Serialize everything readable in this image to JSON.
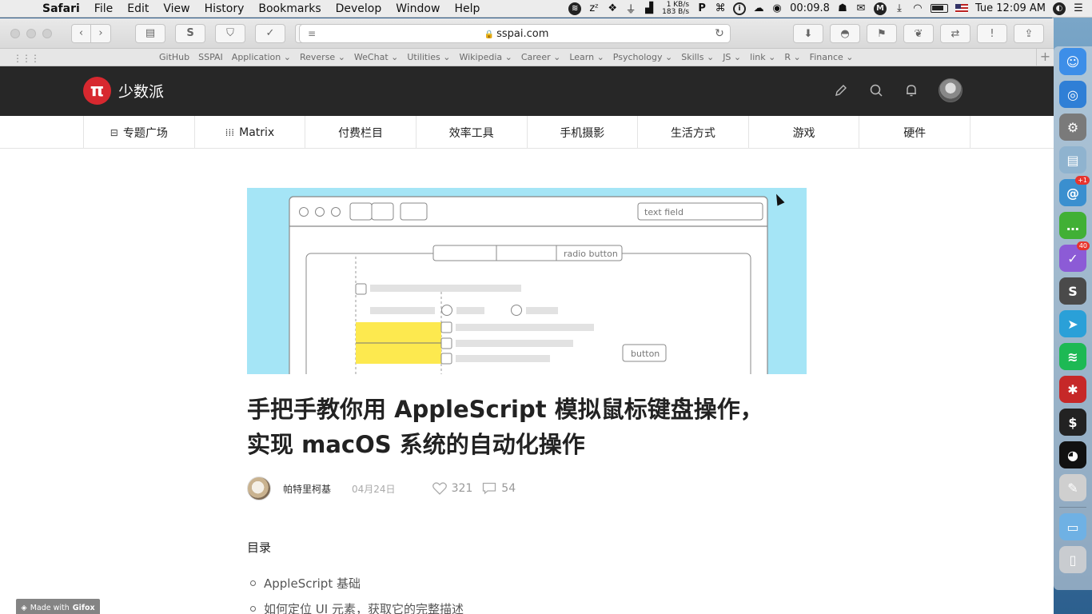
{
  "menubar": {
    "app_name": "Safari",
    "menus": [
      "File",
      "Edit",
      "View",
      "History",
      "Bookmarks",
      "Develop",
      "Window",
      "Help"
    ],
    "net_up": "1 KB/s",
    "net_down": "183 B/s",
    "timer": "00:09.8",
    "clock": "Tue 12:09 AM"
  },
  "browser": {
    "url": "sspai.com",
    "bookmarks": [
      "GitHub",
      "SSPAI",
      "Application ⌄",
      "Reverse ⌄",
      "WeChat ⌄",
      "Utilities ⌄",
      "Wikipedia ⌄",
      "Career ⌄",
      "Learn ⌄",
      "Psychology ⌄",
      "Skills ⌄",
      "JS ⌄",
      "link ⌄",
      "R ⌄",
      "Finance ⌄"
    ]
  },
  "site": {
    "logo_mark": "π",
    "name": "少数派",
    "categories": [
      "专题广场",
      "Matrix",
      "付费栏目",
      "效率工具",
      "手机摄影",
      "生活方式",
      "游戏",
      "硬件"
    ]
  },
  "hero": {
    "text_field": "text field",
    "radio_button": "radio button",
    "button": "button"
  },
  "article": {
    "title_line1": "手把手教你用 AppleScript 模拟鼠标键盘操作，",
    "title_line2": "实现 macOS 系统的自动化操作",
    "author": "帕特里柯基",
    "date": "04月24日",
    "likes": "321",
    "comments": "54",
    "toc_title": "目录",
    "toc": [
      "AppleScript 基础",
      "如何定位 UI 元素，获取它的完整描述"
    ]
  },
  "watermark": {
    "prefix": "Made with",
    "brand": "Gifox"
  },
  "dock": {
    "apps": [
      {
        "name": "finder",
        "color": "#3d8ee8",
        "glyph": "☺"
      },
      {
        "name": "safari",
        "color": "#2f7fd6",
        "glyph": "◎"
      },
      {
        "name": "system-preferences",
        "color": "#7a7a7a",
        "glyph": "⚙"
      },
      {
        "name": "preview",
        "color": "#8fb3cf",
        "glyph": "▤"
      },
      {
        "name": "nautilus",
        "color": "#3a8fcf",
        "glyph": "@",
        "badge": "+1"
      },
      {
        "name": "wechat",
        "color": "#41b035",
        "glyph": "…"
      },
      {
        "name": "omnifocus",
        "color": "#8c5bd6",
        "glyph": "✓",
        "badge": "40"
      },
      {
        "name": "sublime-text",
        "color": "#4a4a4a",
        "glyph": "S"
      },
      {
        "name": "telegram",
        "color": "#2aa0d8",
        "glyph": "➤"
      },
      {
        "name": "spotify",
        "color": "#1db954",
        "glyph": "≋"
      },
      {
        "name": "bugs",
        "color": "#c62828",
        "glyph": "✱"
      },
      {
        "name": "terminal",
        "color": "#222222",
        "glyph": "$"
      },
      {
        "name": "qq",
        "color": "#111111",
        "glyph": "◕"
      },
      {
        "name": "script-editor",
        "color": "#cfcfcf",
        "glyph": "✎"
      },
      {
        "name": "folder",
        "color": "#6fb1e4",
        "glyph": "▭"
      },
      {
        "name": "trash",
        "color": "#c9ccd0",
        "glyph": "▯"
      }
    ]
  }
}
